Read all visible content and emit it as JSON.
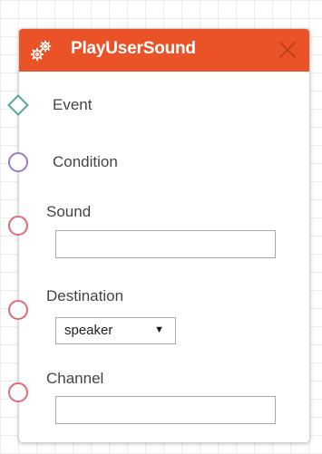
{
  "node": {
    "title": "PlayUserSound",
    "header_icon": "gears-icon",
    "close_icon": "close-x-icon",
    "accent_color": "#ea5328"
  },
  "ports": {
    "event": {
      "label": "Event",
      "shape": "diamond",
      "color": "#5ba79b"
    },
    "condition": {
      "label": "Condition",
      "shape": "circle",
      "color": "#9b79c9"
    },
    "sound": {
      "label": "Sound",
      "shape": "circle",
      "color": "#e26a78",
      "value": "",
      "placeholder": ""
    },
    "destination": {
      "label": "Destination",
      "shape": "circle",
      "color": "#e26a78",
      "selected": "speaker",
      "arrow": "▼"
    },
    "channel": {
      "label": "Channel",
      "shape": "circle",
      "color": "#e26a78",
      "value": "",
      "placeholder": ""
    }
  }
}
